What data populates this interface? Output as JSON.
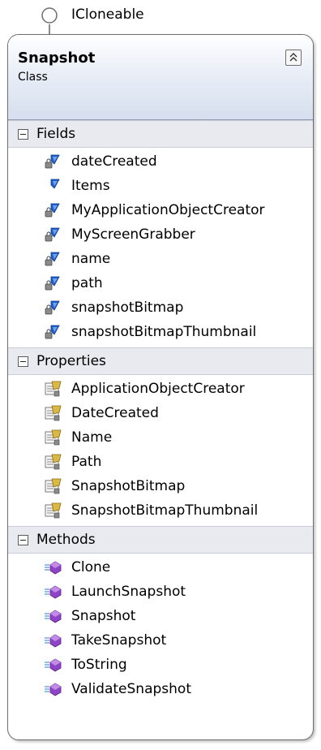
{
  "interface": {
    "name": "ICloneable"
  },
  "class": {
    "name": "Snapshot",
    "kind": "Class"
  },
  "sections": {
    "fields": {
      "label": "Fields",
      "items": [
        {
          "name": "dateCreated",
          "icon": "private-field-icon"
        },
        {
          "name": "Items",
          "icon": "public-field-icon"
        },
        {
          "name": "MyApplicationObjectCreator",
          "icon": "private-field-icon"
        },
        {
          "name": "MyScreenGrabber",
          "icon": "private-field-icon"
        },
        {
          "name": "name",
          "icon": "private-field-icon"
        },
        {
          "name": "path",
          "icon": "private-field-icon"
        },
        {
          "name": "snapshotBitmap",
          "icon": "private-field-icon"
        },
        {
          "name": "snapshotBitmapThumbnail",
          "icon": "private-field-icon"
        }
      ]
    },
    "properties": {
      "label": "Properties",
      "items": [
        {
          "name": "ApplicationObjectCreator",
          "icon": "property-icon"
        },
        {
          "name": "DateCreated",
          "icon": "property-icon"
        },
        {
          "name": "Name",
          "icon": "property-icon"
        },
        {
          "name": "Path",
          "icon": "property-icon"
        },
        {
          "name": "SnapshotBitmap",
          "icon": "property-icon"
        },
        {
          "name": "SnapshotBitmapThumbnail",
          "icon": "property-icon"
        }
      ]
    },
    "methods": {
      "label": "Methods",
      "items": [
        {
          "name": "Clone",
          "icon": "method-icon"
        },
        {
          "name": "LaunchSnapshot",
          "icon": "method-icon"
        },
        {
          "name": "Snapshot",
          "icon": "method-icon"
        },
        {
          "name": "TakeSnapshot",
          "icon": "method-icon"
        },
        {
          "name": "ToString",
          "icon": "method-icon"
        },
        {
          "name": "ValidateSnapshot",
          "icon": "method-icon"
        }
      ]
    }
  },
  "colors": {
    "field": "#1f5fc9",
    "property": "#d9b845",
    "method": "#8e44c7",
    "header": "#d6dfee"
  }
}
